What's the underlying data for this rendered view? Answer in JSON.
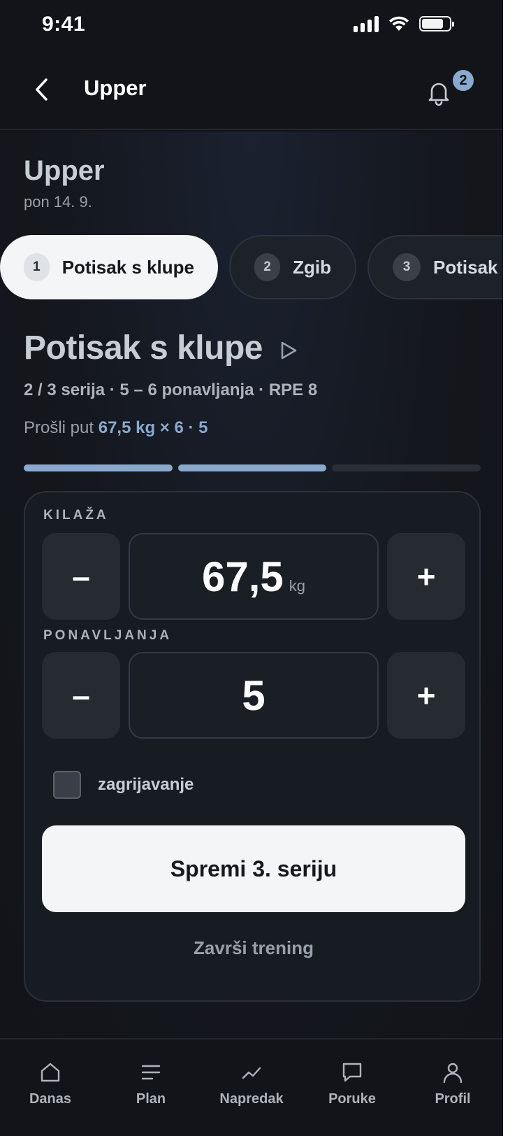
{
  "status_bar": {
    "time": "9:41"
  },
  "header": {
    "title": "Upper",
    "notification_count": "2"
  },
  "workout": {
    "title": "Upper",
    "date": "pon 14. 9."
  },
  "exercise_chips": [
    {
      "number": "1",
      "label": "Potisak s klupe",
      "active": true
    },
    {
      "number": "2",
      "label": "Zgib",
      "active": false
    },
    {
      "number": "3",
      "label": "Potisak i",
      "active": false
    }
  ],
  "exercise": {
    "title": "Potisak s klupe",
    "meta": "2 / 3 serija · 5 – 6 ponavljanja · RPE 8",
    "last_time_label": "Prošli put",
    "last_time_value": "67,5 kg × 6 · 5",
    "sets_total": 3,
    "sets_done": 2
  },
  "logger": {
    "weight_label": "KILAŽA",
    "weight_value": "67,5",
    "weight_unit": "kg",
    "reps_label": "PONAVLJANJA",
    "reps_value": "5",
    "minus_symbol": "–",
    "plus_symbol": "+",
    "warmup_label": "zagrijavanje",
    "warmup_checked": false,
    "save_label": "Spremi 3. seriju",
    "finish_label": "Završi trening"
  },
  "bottom_nav": [
    {
      "label": "Danas",
      "icon": "home-icon"
    },
    {
      "label": "Plan",
      "icon": "list-icon"
    },
    {
      "label": "Napredak",
      "icon": "trend-icon"
    },
    {
      "label": "Poruke",
      "icon": "message-icon"
    },
    {
      "label": "Profil",
      "icon": "user-icon"
    }
  ],
  "colors": {
    "accent": "#8aa9cf",
    "background": "#121419",
    "card": "#171b22",
    "primary_button": "#f3f5f7"
  }
}
